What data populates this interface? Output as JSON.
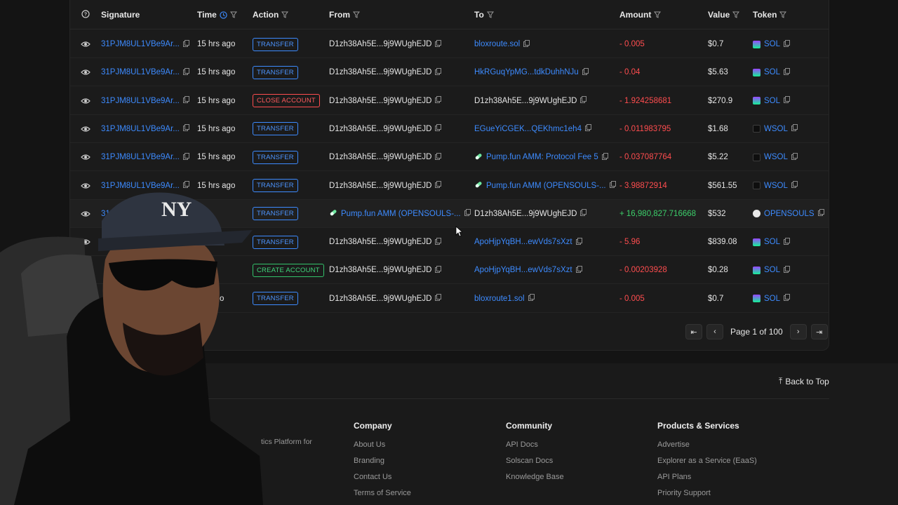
{
  "columns": {
    "signature": "Signature",
    "time": "Time",
    "action": "Action",
    "from": "From",
    "to": "To",
    "amount": "Amount",
    "value": "Value",
    "token": "Token"
  },
  "rows": [
    {
      "sig": "31PJM8UL1VBe9Ar...",
      "time": "15 hrs ago",
      "action": "TRANSFER",
      "action_kind": "transfer",
      "from": "D1zh38Ah5E...9j9WUghEJD",
      "from_link": false,
      "to": "bloxroute.sol",
      "to_link": true,
      "amount": "- 0.005",
      "amount_kind": "neg",
      "value": "$0.7",
      "token": "SOL",
      "token_kind": "sol"
    },
    {
      "sig": "31PJM8UL1VBe9Ar...",
      "time": "15 hrs ago",
      "action": "TRANSFER",
      "action_kind": "transfer",
      "from": "D1zh38Ah5E...9j9WUghEJD",
      "from_link": false,
      "to": "HkRGuqYpMG...tdkDuhhNJu",
      "to_link": true,
      "amount": "- 0.04",
      "amount_kind": "neg",
      "value": "$5.63",
      "token": "SOL",
      "token_kind": "sol"
    },
    {
      "sig": "31PJM8UL1VBe9Ar...",
      "time": "15 hrs ago",
      "action": "CLOSE ACCOUNT",
      "action_kind": "close",
      "from": "D1zh38Ah5E...9j9WUghEJD",
      "from_link": false,
      "to": "D1zh38Ah5E...9j9WUghEJD",
      "to_link": false,
      "amount": "- 1.924258681",
      "amount_kind": "neg",
      "value": "$270.9",
      "token": "SOL",
      "token_kind": "sol"
    },
    {
      "sig": "31PJM8UL1VBe9Ar...",
      "time": "15 hrs ago",
      "action": "TRANSFER",
      "action_kind": "transfer",
      "from": "D1zh38Ah5E...9j9WUghEJD",
      "from_link": false,
      "to": "EGueYiCGEK...QEKhmc1eh4",
      "to_link": true,
      "amount": "- 0.011983795",
      "amount_kind": "neg",
      "value": "$1.68",
      "token": "WSOL",
      "token_kind": "wsol"
    },
    {
      "sig": "31PJM8UL1VBe9Ar...",
      "time": "15 hrs ago",
      "action": "TRANSFER",
      "action_kind": "transfer",
      "from": "D1zh38Ah5E...9j9WUghEJD",
      "from_link": false,
      "to": "Pump.fun AMM: Protocol Fee 5",
      "to_link": true,
      "to_pill": true,
      "amount": "- 0.037087764",
      "amount_kind": "neg",
      "value": "$5.22",
      "token": "WSOL",
      "token_kind": "wsol"
    },
    {
      "sig": "31PJM8UL1VBe9Ar...",
      "time": "15 hrs ago",
      "action": "TRANSFER",
      "action_kind": "transfer",
      "from": "D1zh38Ah5E...9j9WUghEJD",
      "from_link": false,
      "to": "Pump.fun AMM (OPENSOULS-...",
      "to_link": true,
      "to_pill": true,
      "amount": "- 3.98872914",
      "amount_kind": "neg",
      "value": "$561.55",
      "token": "WSOL",
      "token_kind": "wsol"
    },
    {
      "sig": "31P",
      "time": "ago",
      "action": "TRANSFER",
      "action_kind": "transfer",
      "from": "Pump.fun AMM (OPENSOULS-...",
      "from_link": true,
      "from_pill": true,
      "to": "D1zh38Ah5E...9j9WUghEJD",
      "to_link": false,
      "amount": "+ 16,980,827.716668",
      "amount_kind": "pos",
      "value": "$532",
      "token": "OPENSOULS",
      "token_kind": "ops"
    },
    {
      "sig": "",
      "time": "ago",
      "action": "TRANSFER",
      "action_kind": "transfer",
      "from": "D1zh38Ah5E...9j9WUghEJD",
      "from_link": false,
      "to": "ApoHjpYqBH...ewVds7sXzt",
      "to_link": true,
      "amount": "- 5.96",
      "amount_kind": "neg",
      "value": "$839.08",
      "token": "SOL",
      "token_kind": "sol"
    },
    {
      "sig": "",
      "time": "ago",
      "action": "CREATE ACCOUNT",
      "action_kind": "create",
      "from": "D1zh38Ah5E...9j9WUghEJD",
      "from_link": false,
      "to": "ApoHjpYqBH...ewVds7sXzt",
      "to_link": true,
      "amount": "- 0.00203928",
      "amount_kind": "neg",
      "value": "$0.28",
      "token": "SOL",
      "token_kind": "sol"
    },
    {
      "sig": "",
      "time": "hrs ago",
      "action": "TRANSFER",
      "action_kind": "transfer",
      "from": "D1zh38Ah5E...9j9WUghEJD",
      "from_link": false,
      "to": "bloxroute1.sol",
      "to_link": true,
      "amount": "- 0.005",
      "amount_kind": "neg",
      "value": "$0.7",
      "token": "SOL",
      "token_kind": "sol"
    }
  ],
  "pagination": {
    "label": "Page 1 of 100"
  },
  "footer": {
    "back_to_top": "Back to Top",
    "desc_fragment": "tics Platform for",
    "company": {
      "title": "Company",
      "links": [
        "About Us",
        "Branding",
        "Contact Us",
        "Terms of Service"
      ]
    },
    "community": {
      "title": "Community",
      "links": [
        "API Docs",
        "Solscan Docs",
        "Knowledge Base"
      ]
    },
    "products": {
      "title": "Products & Services",
      "links": [
        "Advertise",
        "Explorer as a Service (EaaS)",
        "API Plans",
        "Priority Support"
      ]
    }
  },
  "colors": {
    "link": "#3d8bff",
    "negative": "#ff4d4f",
    "positive": "#3ccf6a",
    "background": "#141414"
  },
  "icons": [
    "info-icon",
    "clock-icon",
    "filter-icon",
    "eye-icon",
    "copy-icon",
    "solana-icon",
    "pill-icon",
    "first-page-icon",
    "prev-page-icon",
    "next-page-icon",
    "last-page-icon",
    "arrow-up-icon"
  ]
}
